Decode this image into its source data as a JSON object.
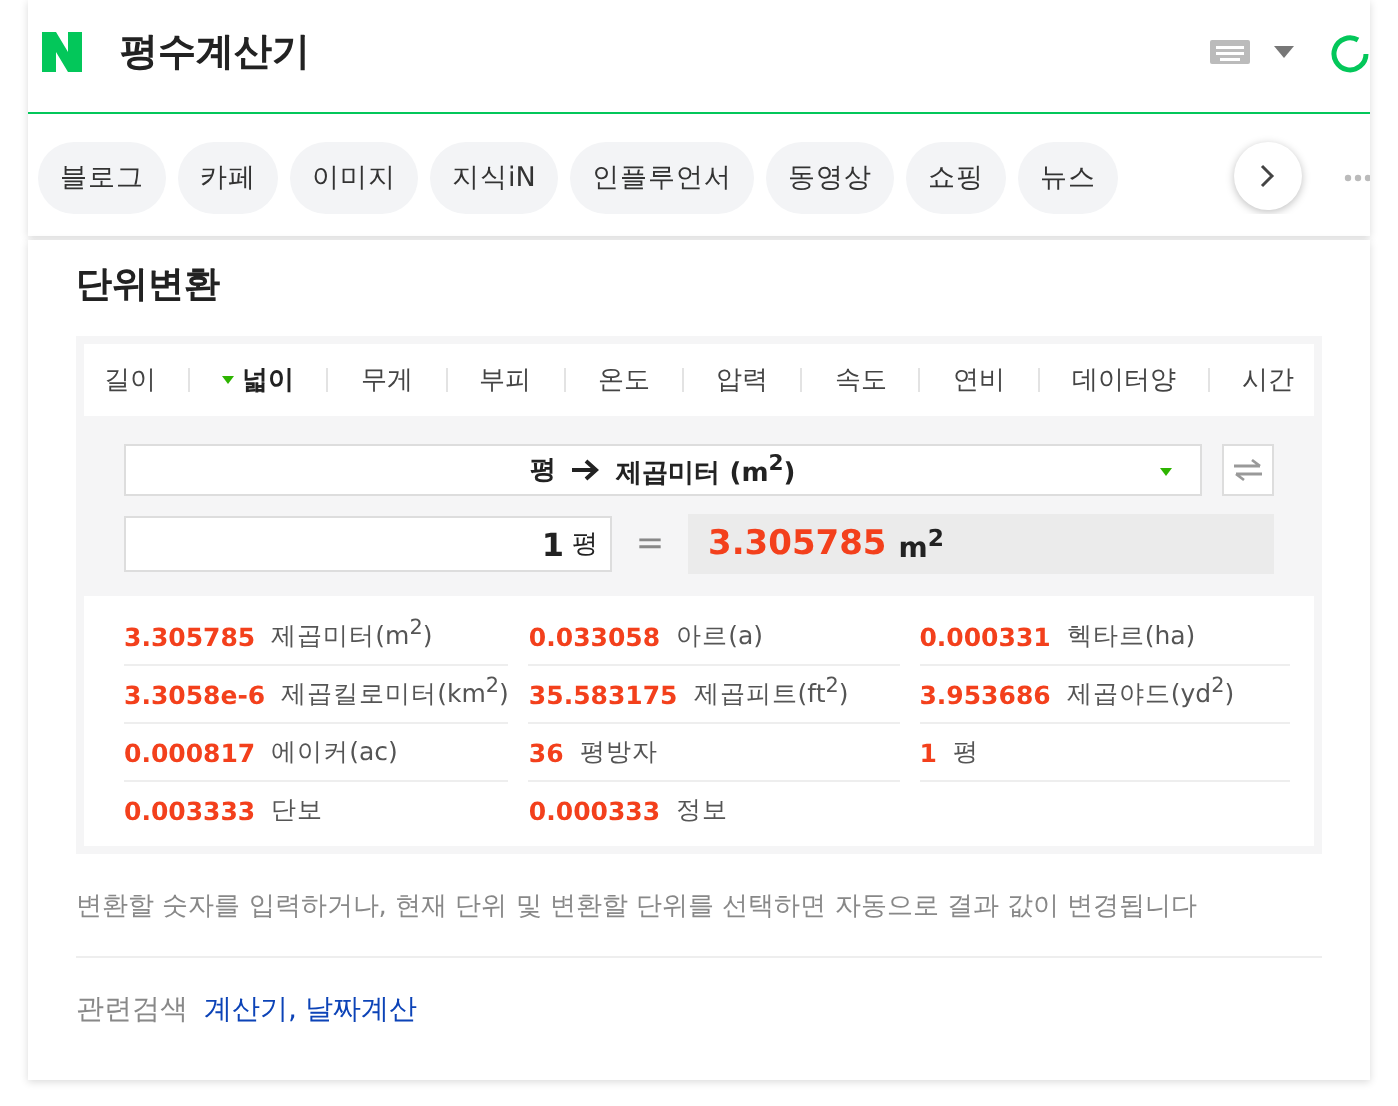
{
  "search": {
    "query": "평수계산기"
  },
  "chips": [
    {
      "label": "블로그"
    },
    {
      "label": "카페"
    },
    {
      "label": "이미지"
    },
    {
      "label": "지식iN"
    },
    {
      "label": "인플루언서"
    },
    {
      "label": "동영상"
    },
    {
      "label": "쇼핑"
    },
    {
      "label": "뉴스"
    }
  ],
  "converter": {
    "title": "단위변환",
    "tabs": [
      {
        "label": "길이",
        "selected": false
      },
      {
        "label": "넓이",
        "selected": true
      },
      {
        "label": "무게",
        "selected": false
      },
      {
        "label": "부피",
        "selected": false
      },
      {
        "label": "온도",
        "selected": false
      },
      {
        "label": "압력",
        "selected": false
      },
      {
        "label": "속도",
        "selected": false
      },
      {
        "label": "연비",
        "selected": false
      },
      {
        "label": "데이터양",
        "selected": false
      },
      {
        "label": "시간",
        "selected": false
      }
    ],
    "from_unit": "평",
    "to_unit": "제곱미터 (m$^{2}$)",
    "input": {
      "value": "1",
      "unit": "평"
    },
    "equals": "=",
    "result": {
      "value": "3.305785",
      "unit": "m$^{2}$"
    },
    "results": [
      {
        "value": "3.305785",
        "unit": "제곱미터(m$^{2}$)"
      },
      {
        "value": "0.033058",
        "unit": "아르(a)"
      },
      {
        "value": "0.000331",
        "unit": "헥타르(ha)"
      },
      {
        "value": "3.3058e-6",
        "unit": "제곱킬로미터(km$^{2}$)"
      },
      {
        "value": "35.583175",
        "unit": "제곱피트(ft$^{2}$)"
      },
      {
        "value": "3.953686",
        "unit": "제곱야드(yd$^{2}$)"
      },
      {
        "value": "0.000817",
        "unit": "에이커(ac)"
      },
      {
        "value": "36",
        "unit": "평방자"
      },
      {
        "value": "1",
        "unit": "평"
      },
      {
        "value": "0.003333",
        "unit": "단보"
      },
      {
        "value": "0.000333",
        "unit": "정보"
      }
    ],
    "note": "변환할 숫자를 입력하거나, 현재 단위 및 변환할 단위를 선택하면 자동으로 결과 값이 변경됩니다",
    "related": {
      "label": "관련검색",
      "links": [
        "계산기",
        "날짜계산"
      ],
      "separator": ","
    }
  }
}
